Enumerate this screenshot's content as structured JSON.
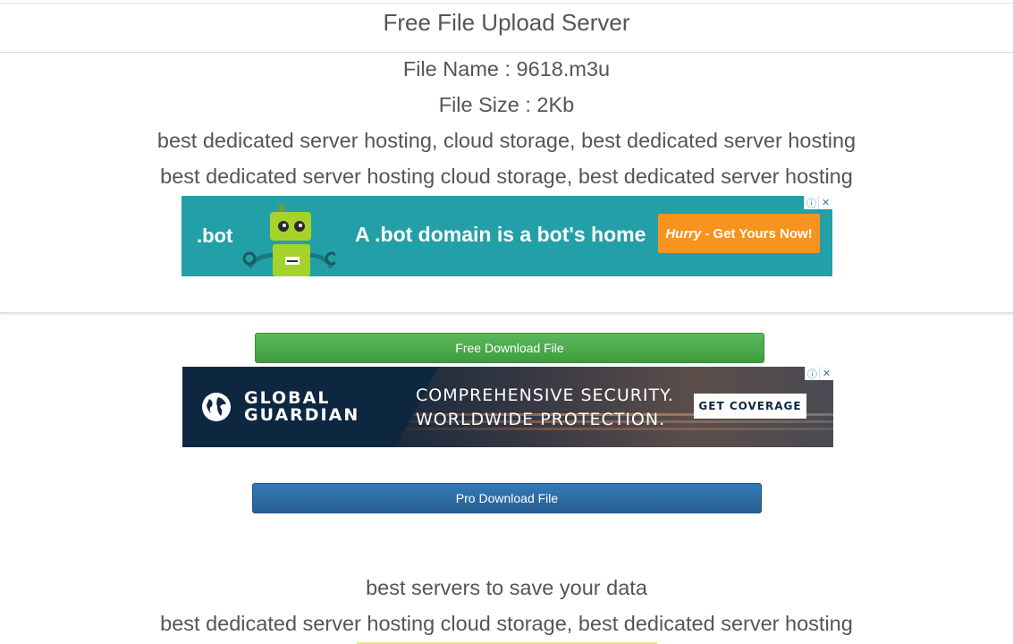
{
  "header": {
    "title": "Free File Upload Server"
  },
  "file": {
    "name_text": "File Name : 9618.m3u",
    "size_text": "File Size : 2Kb"
  },
  "promo_lines": {
    "line1": "best dedicated server hosting, cloud storage, best dedicated server hosting",
    "line2": "best dedicated server hosting cloud storage, best dedicated server hosting"
  },
  "ad_bot": {
    "logo": ".bot",
    "headline": "A .bot domain is a bot's home",
    "cta_emph": "Hurry",
    "cta_rest": "- Get Yours Now!",
    "info_icon": "info-icon",
    "close_icon": "close-icon",
    "colors": {
      "bg": "#23a0a7",
      "cta": "#f7931e"
    }
  },
  "buttons": {
    "free_download": "Free Download File",
    "pro_download": "Pro Download File",
    "colors": {
      "free": "#4cae4c",
      "pro": "#2e6da4"
    }
  },
  "ad_guardian": {
    "brand_line1": "GLOBAL",
    "brand_line2": "GUARDIAN",
    "headline_line1": "COMPREHENSIVE SECURITY.",
    "headline_line2": "WORLDWIDE PROTECTION.",
    "cta": "GET COVERAGE",
    "colors": {
      "bg": "#0d2740"
    }
  },
  "footer": {
    "line1": "best servers to save your data",
    "line2": "best dedicated server hosting cloud storage, best dedicated server hosting"
  }
}
